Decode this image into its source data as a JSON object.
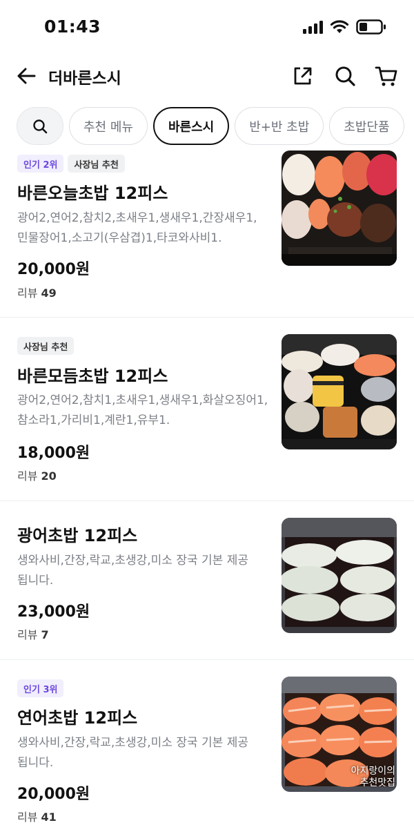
{
  "status_bar": {
    "time": "01:43"
  },
  "header": {
    "title": "더바른스시"
  },
  "chips": [
    {
      "label": "추천 메뉴",
      "active": false
    },
    {
      "label": "바른스시",
      "active": true
    },
    {
      "label": "반+반 초밥",
      "active": false
    },
    {
      "label": "초밥단품",
      "active": false
    }
  ],
  "items": [
    {
      "badges": [
        "인기 2위",
        "사장님 추천"
      ],
      "name": "바른오늘초밥 12피스",
      "desc": "광어2,연어2,참치2,초새우1,생새우1,간장새우1,민물장어1,소고기(우삼겹)1,타코와사비1.",
      "price": "20,000원",
      "review_label": "리뷰",
      "review_count": "49"
    },
    {
      "badges": [
        "사장님 추천"
      ],
      "name": "바른모듬초밥 12피스",
      "desc": "광어2,연어2,참치1,초새우1,생새우1,화살오징어1,참소라1,가리비1,계란1,유부1.",
      "price": "18,000원",
      "review_label": "리뷰",
      "review_count": "20"
    },
    {
      "badges": [],
      "name": "광어초밥 12피스",
      "desc": "생와사비,간장,락교,초생강,미소 장국 기본 제공 됩니다.",
      "price": "23,000원",
      "review_label": "리뷰",
      "review_count": "7"
    },
    {
      "badges": [
        "인기 3위"
      ],
      "name": "연어초밥 12피스",
      "desc": "생와사비,간장,락교,초생강,미소 장국 기본 제공 됩니다.",
      "price": "20,000원",
      "review_label": "리뷰",
      "review_count": "41",
      "image_watermark": "아지랑이의 추천맛집"
    }
  ]
}
